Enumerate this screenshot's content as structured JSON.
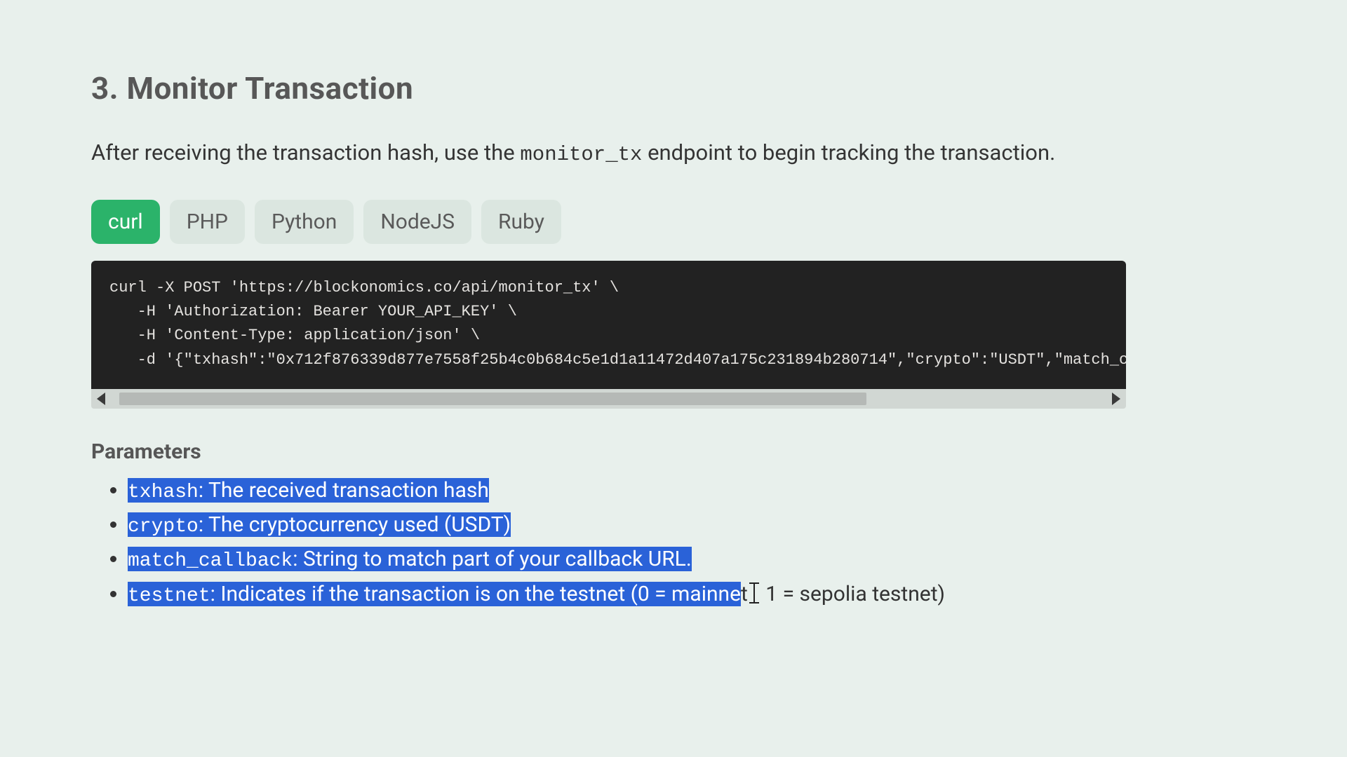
{
  "heading": "3. Monitor Transaction",
  "intro_pre": "After receiving the transaction hash, use the ",
  "intro_code": "monitor_tx",
  "intro_post": " endpoint to begin tracking the transaction.",
  "tabs": {
    "curl": "curl",
    "php": "PHP",
    "python": "Python",
    "nodejs": "NodeJS",
    "ruby": "Ruby"
  },
  "code": "curl -X POST 'https://blockonomics.co/api/monitor_tx' \\\n   -H 'Authorization: Bearer YOUR_API_KEY' \\\n   -H 'Content-Type: application/json' \\\n   -d '{\"txhash\":\"0x712f876339d877e7558f25b4c0b684c5e1d1a11472d407a175c231894b280714\",\"crypto\":\"USDT\",\"match_callbac",
  "params_heading": "Parameters",
  "params": {
    "p1_name": "txhash",
    "p1_desc": ": The received transaction hash",
    "p2_name": "crypto",
    "p2_desc": ": The cryptocurrency used (USDT)",
    "p3_name": "match_callback",
    "p3_desc": ": String to match part of your callback URL.",
    "p4_name": "testnet",
    "p4_desc_sel": ": Indicates if the transaction is on the testnet (0 = mainne",
    "p4_desc_rest_a": "t",
    "p4_desc_rest_b": " 1 = sepolia testnet)"
  }
}
